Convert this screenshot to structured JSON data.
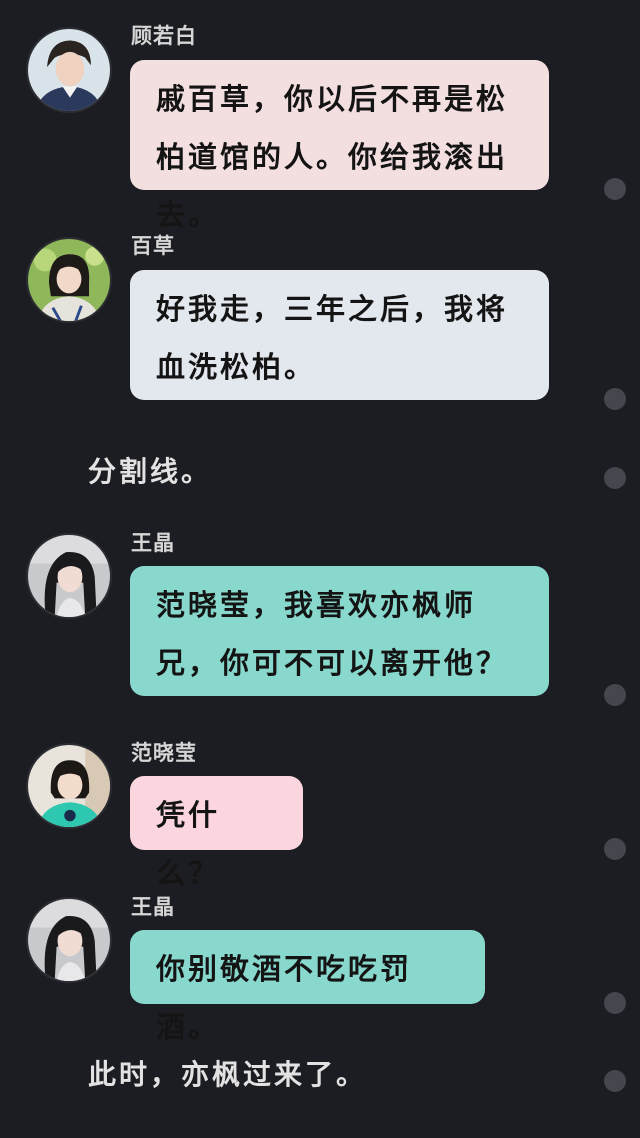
{
  "messages": [
    {
      "name": "顾若白",
      "text": "戚百草，你以后不再是松柏道馆的人。你给我滚出去。",
      "bubble_color": "#f3dfe0"
    },
    {
      "name": "百草",
      "text": "好我走，三年之后，我将血洗松柏。",
      "bubble_color": "#e3e7ee"
    },
    {
      "name": "王晶",
      "text": "范晓莹，我喜欢亦枫师兄，你可不可以离开他？",
      "bubble_color": "#88d8cd"
    },
    {
      "name": "范晓莹",
      "text": "凭什么？",
      "bubble_color": "#fbd6df"
    },
    {
      "name": "王晶",
      "text": "你别敬酒不吃吃罚酒。",
      "bubble_color": "#88d8cd"
    }
  ],
  "narrations": [
    "分割线。",
    "此时，亦枫过来了。"
  ],
  "avatars": [
    "young-man-avatar",
    "girl-with-bangs-avatar",
    "long-hair-woman-avatar",
    "girl-green-top-avatar",
    "long-hair-woman-avatar"
  ],
  "colors": {
    "background": "#1c1d22",
    "dot": "#45474e"
  }
}
